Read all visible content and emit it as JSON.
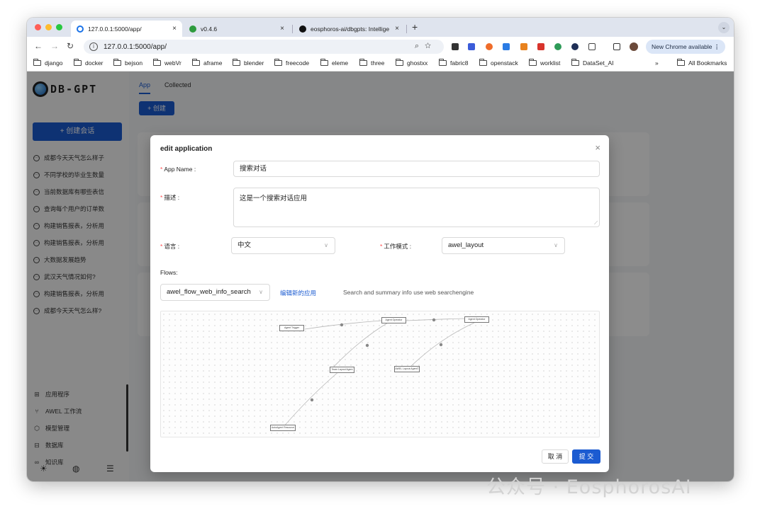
{
  "browser": {
    "tabs": [
      {
        "title": "127.0.0.1:5000/app/",
        "close": "×",
        "favicon_color": "#1b73e8"
      },
      {
        "title": "v0.4.6",
        "close": "×",
        "favicon_color": "#2e9b3e"
      },
      {
        "title": "eosphoros-ai/dbgpts: Intellige",
        "close": "×",
        "favicon_color": "#111111"
      }
    ],
    "new_tab": "+",
    "tab_menu": "⌄",
    "url": "127.0.0.1:5000/app/",
    "new_chrome": "New Chrome available",
    "bookmarks": [
      "django",
      "docker",
      "bejson",
      "webVr",
      "aframe",
      "blender",
      "freecode",
      "eleme",
      "three",
      "ghostxx",
      "fabric8",
      "openstack",
      "worklist",
      "DataSet_AI"
    ],
    "bookmarks_more": "»",
    "all_bookmarks": "All Bookmarks",
    "extension_colors": [
      "#333333",
      "#3b5cd9",
      "#ef6c2a",
      "#2a7be4",
      "#e8821e",
      "#d8342c",
      "#2e9b58",
      "#1f2f56"
    ]
  },
  "app": {
    "logo": "DB-GPT",
    "new_chat": "+ 创建会话",
    "conversations": [
      "成都今天天气怎么样子",
      "不同学校的毕业生数量",
      "当前数据库有哪些表信",
      "查询每个用户的订单数",
      "构建销售报表，分析用",
      "构建销售报表，分析用",
      "大数据发展趋势",
      "武汉天气情况如何?",
      "构建销售报表，分析用",
      "成都今天天气怎么样?"
    ],
    "menu": [
      {
        "label": "应用程序",
        "icon": "apps-icon",
        "glyph": "⊞"
      },
      {
        "label": "AWEL 工作流",
        "icon": "workflow-icon",
        "glyph": "⑂"
      },
      {
        "label": "模型管理",
        "icon": "model-icon",
        "glyph": "⬡"
      },
      {
        "label": "数据库",
        "icon": "database-icon",
        "glyph": "⊟"
      },
      {
        "label": "知识库",
        "icon": "knowledge-icon",
        "glyph": "∞"
      }
    ],
    "main_tabs": [
      "App",
      "Collected"
    ],
    "create_button": "+ 创建"
  },
  "modal": {
    "title": "edit application",
    "close": "×",
    "app_name_label": "App Name",
    "app_name_value": "搜索对话",
    "desc_label": "描述",
    "desc_value": "这是一个搜索对话应用",
    "lang_label": "语言",
    "lang_value": "中文",
    "mode_label": "工作模式",
    "mode_value": "awel_layout",
    "flows_label": "Flows:",
    "flow_value": "awel_flow_web_info_search",
    "edit_link": "编辑新的应用",
    "flow_desc": "Search and summary info use web searchengine",
    "nodes": [
      "Agent Trigger",
      "Agent Operator",
      "Agent Operator",
      "Team Layout Agent",
      "AWEL Layout AgentT",
      "AutoAgent Resource"
    ],
    "cancel": "取 消",
    "submit": "提 交",
    "required_mark": "*",
    "colon": ":"
  },
  "watermark": "公众号 · EosphorosAI"
}
